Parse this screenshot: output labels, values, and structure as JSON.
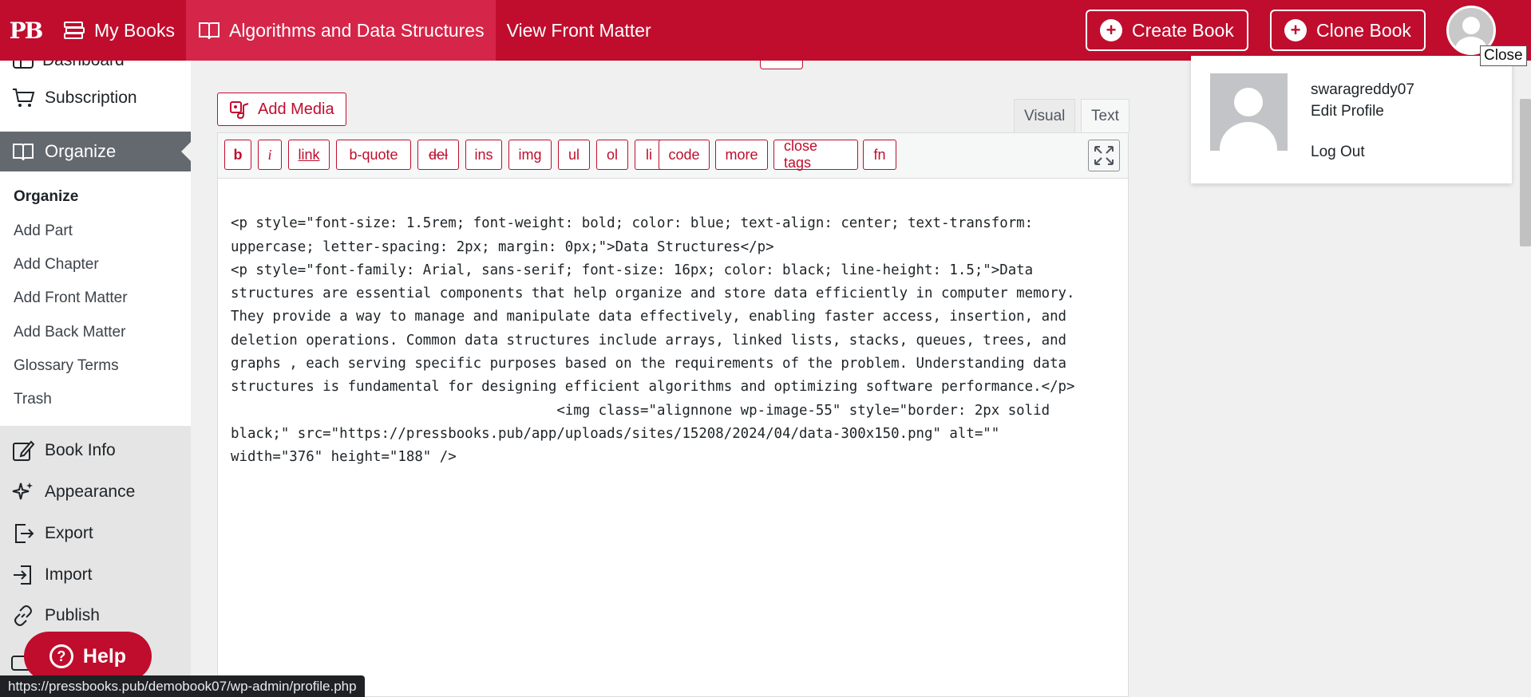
{
  "topbar": {
    "logo": "PB",
    "my_books": "My Books",
    "book_title": "Algorithms and Data Structures",
    "view_front_matter": "View Front Matter",
    "create_book": "Create Book",
    "clone_book": "Clone Book",
    "close_tooltip": "Close",
    "bg_color": "#c00d2d"
  },
  "sidebar": {
    "partial_item": "Dashboard",
    "subscription": "Subscription",
    "organize_current": "Organize",
    "submenu": {
      "organize": "Organize",
      "add_part": "Add Part",
      "add_chapter": "Add Chapter",
      "add_front_matter": "Add Front Matter",
      "add_back_matter": "Add Back Matter",
      "glossary_terms": "Glossary Terms",
      "trash": "Trash"
    },
    "book_info": "Book Info",
    "appearance": "Appearance",
    "export": "Export",
    "import": "Import",
    "publish": "Publish",
    "help": "Help"
  },
  "editor": {
    "add_media": "Add Media",
    "tab_visual": "Visual",
    "tab_text": "Text",
    "quicktags": {
      "b": "b",
      "i": "i",
      "link": "link",
      "bquote": "b-quote",
      "del": "del",
      "ins": "ins",
      "img": "img",
      "ul": "ul",
      "ol": "ol",
      "li": "li",
      "code": "code",
      "more": "more",
      "close_tags": "close tags",
      "fn": "fn"
    },
    "content_lines": [
      "<p style=\"font-size: 1.5rem; font-weight: bold; color: blue; text-align: center; text-transform:",
      "uppercase; letter-spacing: 2px; margin: 0px;\">Data Structures</p>",
      "<p style=\"font-family: Arial, sans-serif; font-size: 16px; color: black; line-height: 1.5;\">Data",
      "structures are essential components that help organize and store data efficiently in computer memory.",
      "They provide a way to manage and manipulate data effectively, enabling faster access, insertion, and",
      "deletion operations. Common data structures include arrays, linked lists, stacks, queues, trees, and",
      "graphs , each serving specific purposes based on the requirements of the problem. Understanding data",
      "structures is fundamental for designing efficient algorithms and optimizing software performance.</p>",
      "                                       <img class=\"alignnone wp-image-55\" style=\"border: 2px solid",
      "black;\" src=\"https://pressbooks.pub/app/uploads/sites/15208/2024/04/data-300x150.png\" alt=\"\"",
      "width=\"376\" height=\"188\" />"
    ]
  },
  "profile": {
    "username": "swaragreddy07",
    "edit_profile": "Edit Profile",
    "log_out": "Log Out"
  },
  "statusbar": {
    "url": "https://pressbooks.pub/demobook07/wp-admin/profile.php"
  }
}
